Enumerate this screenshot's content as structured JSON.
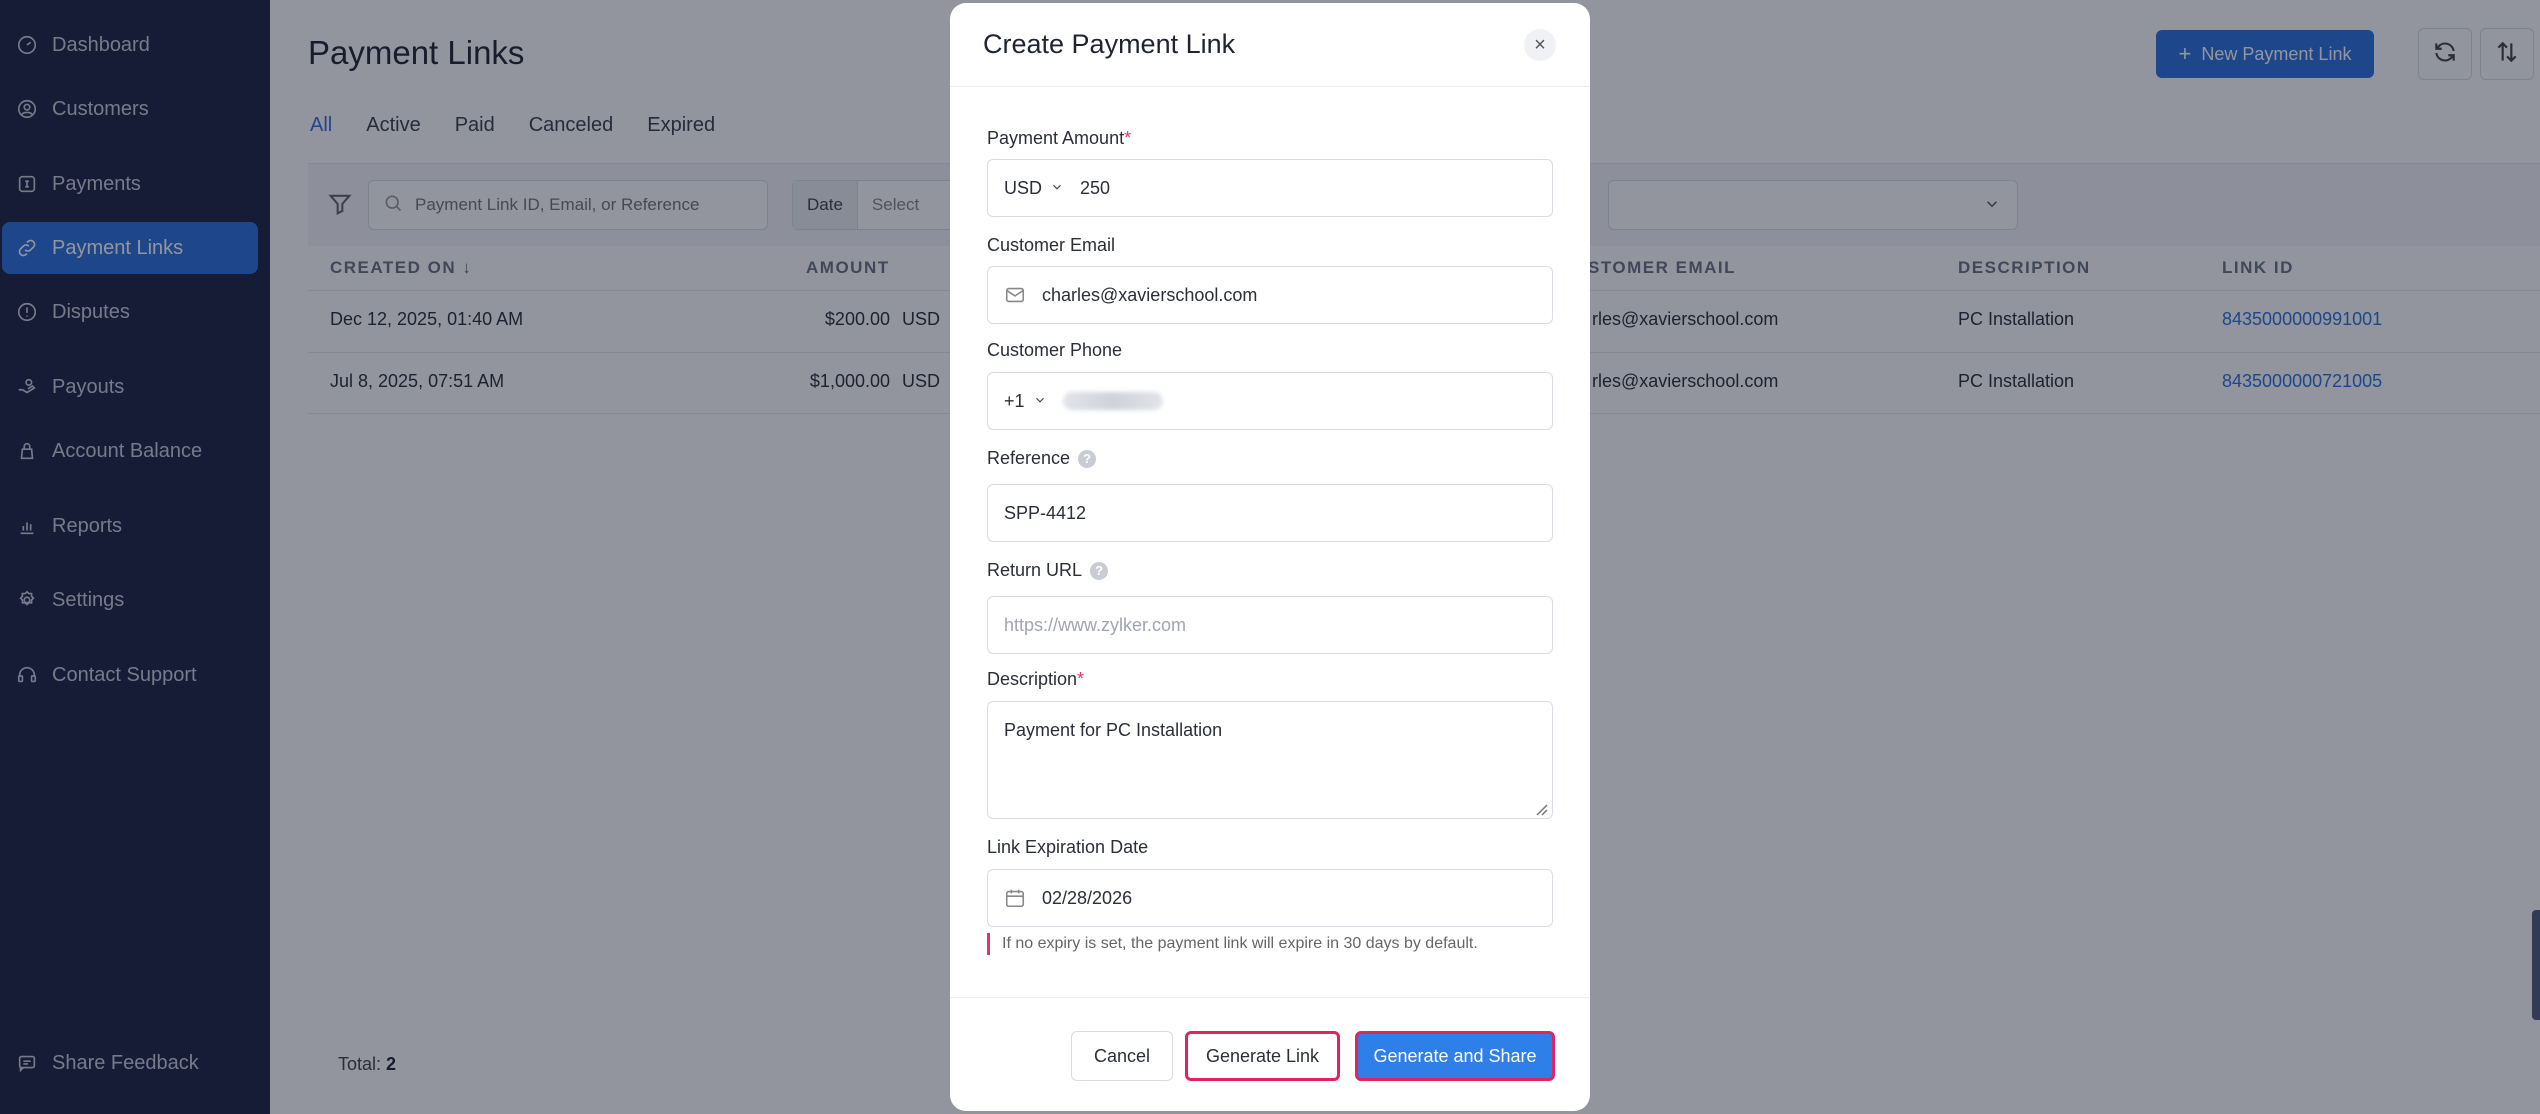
{
  "sidebar": {
    "items": [
      {
        "label": "Dashboard",
        "icon": "dashboard-icon"
      },
      {
        "label": "Customers",
        "icon": "customers-icon"
      },
      {
        "label": "Payments",
        "icon": "payments-icon"
      },
      {
        "label": "Payment Links",
        "icon": "link-icon",
        "active": true
      },
      {
        "label": "Disputes",
        "icon": "disputes-icon"
      },
      {
        "label": "Payouts",
        "icon": "payouts-icon"
      },
      {
        "label": "Account Balance",
        "icon": "balance-icon"
      },
      {
        "label": "Reports",
        "icon": "reports-icon"
      },
      {
        "label": "Settings",
        "icon": "settings-icon"
      },
      {
        "label": "Contact Support",
        "icon": "support-icon"
      }
    ],
    "share_feedback": "Share Feedback"
  },
  "header": {
    "title": "Payment Links",
    "new_button": "New Payment Link"
  },
  "tabs": [
    "All",
    "Active",
    "Paid",
    "Canceled",
    "Expired"
  ],
  "filters": {
    "search_placeholder": "Payment Link ID, Email, or Reference",
    "date_label": "Date",
    "date_value": "Select"
  },
  "table": {
    "columns": [
      "CREATED ON",
      "AMOUNT",
      "CUSTOMER EMAIL",
      "DESCRIPTION",
      "LINK ID"
    ],
    "column_fragments": {
      "email_partial": "STOMER EMAIL"
    },
    "rows": [
      {
        "created_on": "Dec 12, 2025, 01:40 AM",
        "amount": "$200.00",
        "currency": "USD",
        "email": "rles@xavierschool.com",
        "description": "PC Installation",
        "link_id": "8435000000991001"
      },
      {
        "created_on": "Jul 8, 2025, 07:51 AM",
        "amount": "$1,000.00",
        "currency": "USD",
        "email": "rles@xavierschool.com",
        "description": "PC Installation",
        "link_id": "8435000000721005"
      }
    ],
    "total_label": "Total:",
    "total_value": "2"
  },
  "modal": {
    "title": "Create Payment Link",
    "amount_label": "Payment Amount",
    "currency": "USD",
    "amount_value": "250",
    "email_label": "Customer Email",
    "email_value": "charles@xavierschool.com",
    "phone_label": "Customer Phone",
    "phone_code": "+1",
    "reference_label": "Reference",
    "reference_value": "SPP-4412",
    "return_url_label": "Return URL",
    "return_url_placeholder": "https://www.zylker.com",
    "description_label": "Description",
    "description_value": "Payment for PC Installation",
    "expiry_label": "Link Expiration Date",
    "expiry_value": "02/28/2026",
    "hint": "If no expiry is set, the payment link will expire in 30 days by default.",
    "cancel": "Cancel",
    "generate": "Generate Link",
    "generate_share": "Generate and Share",
    "required_mark": "*"
  },
  "colors": {
    "sidebar_bg": "#1c2342",
    "accent": "#2a6fdb",
    "highlight": "#e0245e"
  }
}
